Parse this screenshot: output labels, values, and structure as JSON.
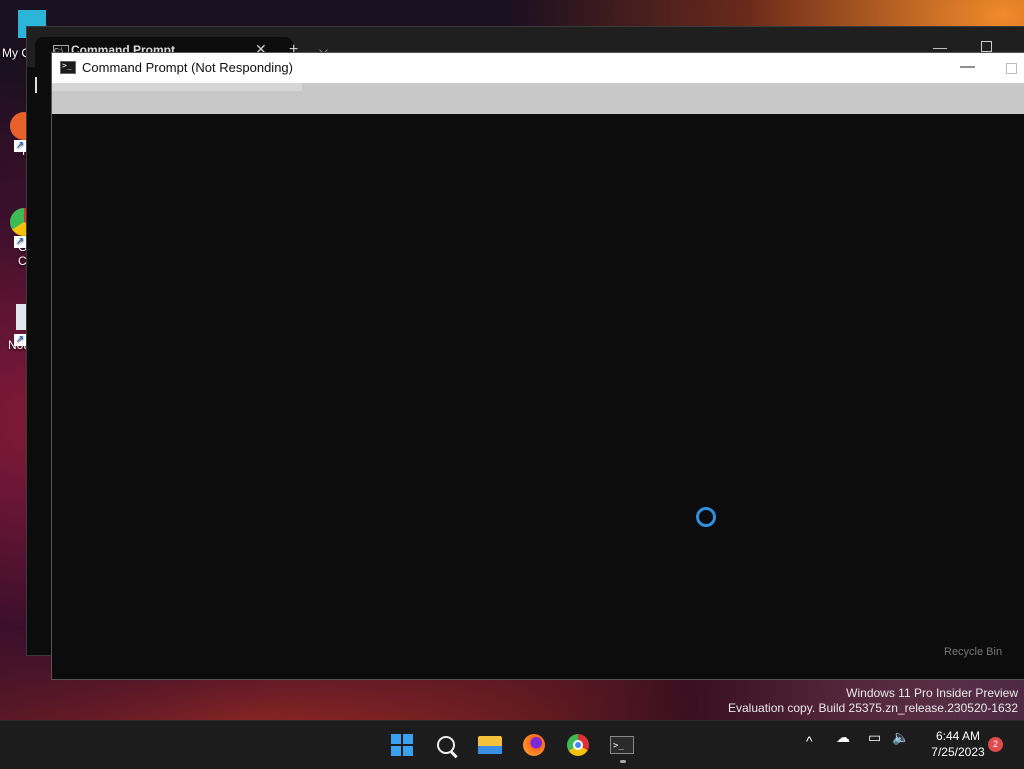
{
  "desktop": {
    "icons": [
      {
        "label": "My C"
      },
      {
        "label": "F"
      },
      {
        "label": "G"
      },
      {
        "label": "C"
      },
      {
        "label": "Not"
      }
    ],
    "recycle_bin_label": "Recycle Bin",
    "watermark": {
      "line1": "Windows 11 Pro Insider Preview",
      "line2": "Evaluation copy. Build 25375.zn_release.230520-1632"
    }
  },
  "back_window": {
    "tab_title": "Command Prompt",
    "tab_close": "✕",
    "new_tab": "+",
    "tab_dropdown": "⌵",
    "minimize": "—"
  },
  "front_window": {
    "title": "Command Prompt (Not Responding)",
    "minimize": "—"
  },
  "taskbar": {
    "apps": [
      {
        "name": "start",
        "icon": "windows-start-icon"
      },
      {
        "name": "search",
        "icon": "search-icon"
      },
      {
        "name": "file-explorer",
        "icon": "folder-icon"
      },
      {
        "name": "firefox",
        "icon": "firefox-icon"
      },
      {
        "name": "chrome",
        "icon": "chrome-icon"
      },
      {
        "name": "terminal",
        "icon": "terminal-icon",
        "active": true
      }
    ],
    "tray": {
      "chevron": "^",
      "time": "6:44 AM",
      "date": "7/25/2023",
      "notification_count": "2"
    },
    "accent_color": "#3aa0f0"
  }
}
